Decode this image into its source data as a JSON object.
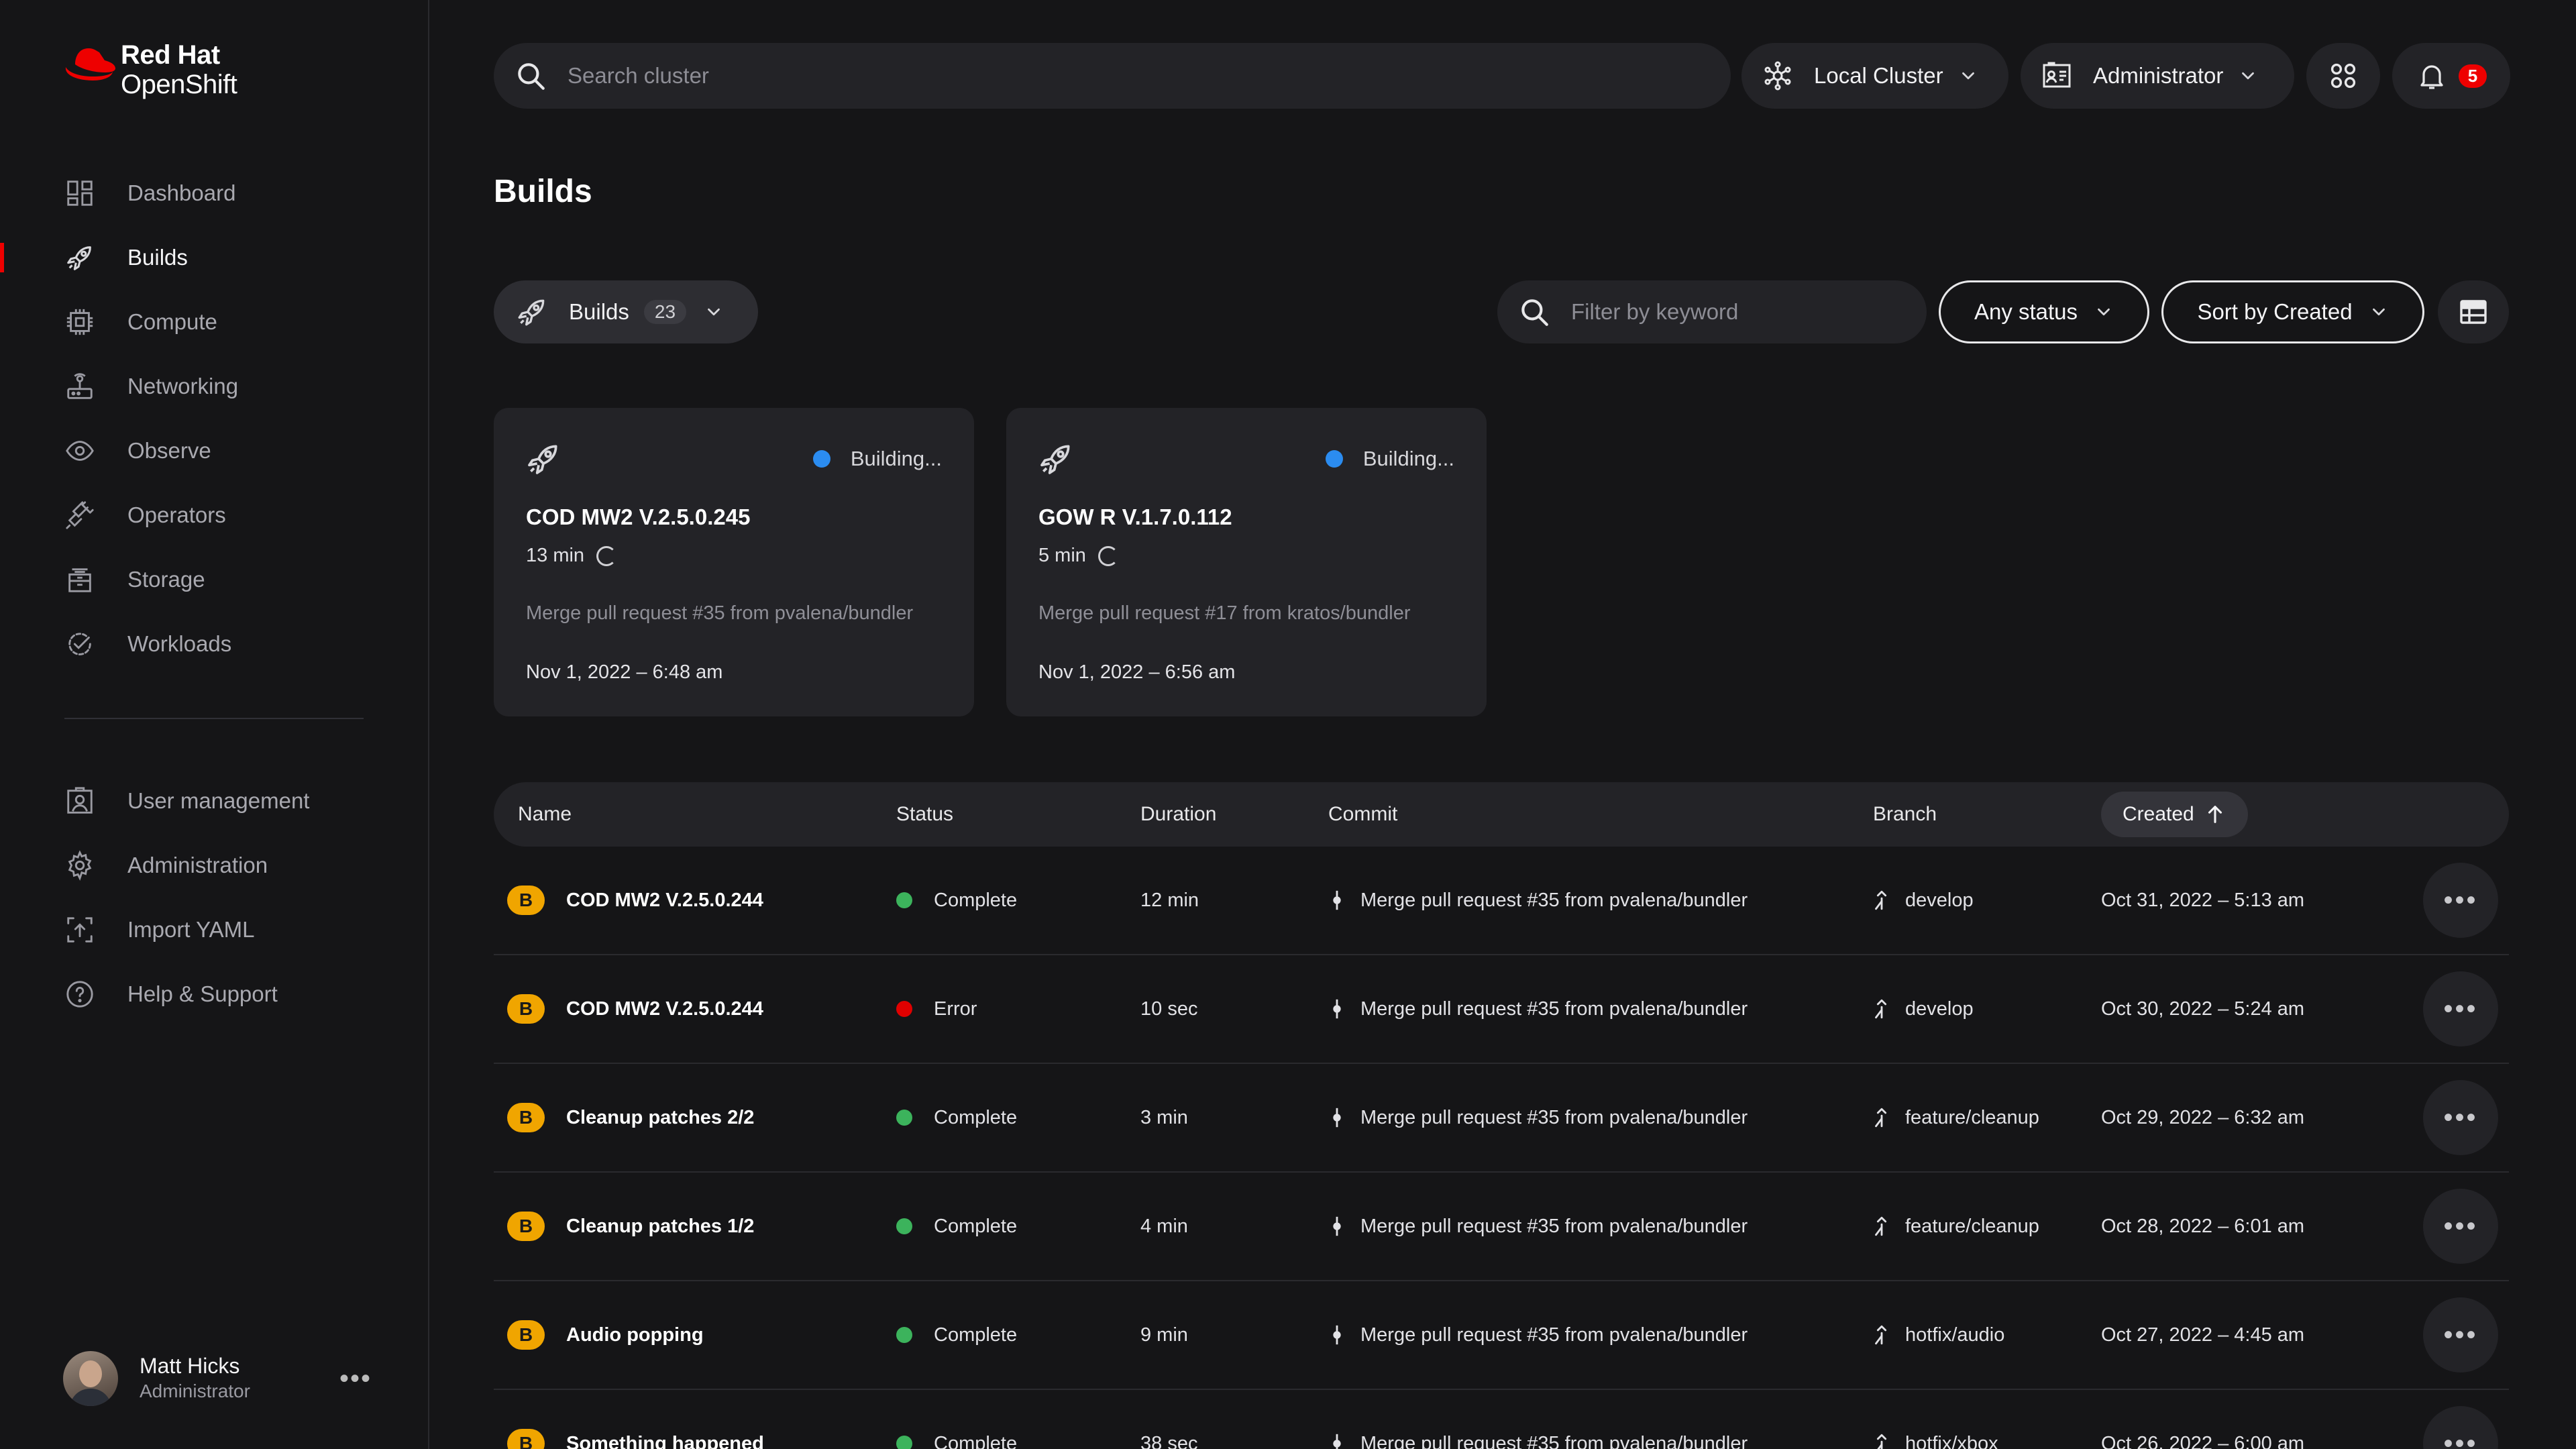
{
  "brand": {
    "line1": "Red Hat",
    "line2": "OpenShift",
    "color": "#ee0000"
  },
  "sidebar": {
    "items": [
      {
        "label": "Dashboard",
        "icon": "dashboard-icon"
      },
      {
        "label": "Builds",
        "icon": "rocket-icon",
        "active": true
      },
      {
        "label": "Compute",
        "icon": "chip-icon"
      },
      {
        "label": "Networking",
        "icon": "network-icon"
      },
      {
        "label": "Observe",
        "icon": "eye-icon"
      },
      {
        "label": "Operators",
        "icon": "plug-icon"
      },
      {
        "label": "Storage",
        "icon": "storage-icon"
      },
      {
        "label": "Workloads",
        "icon": "workloads-icon"
      }
    ],
    "secondary": [
      {
        "label": "User management",
        "icon": "user-card-icon"
      },
      {
        "label": "Administration",
        "icon": "gear-icon"
      },
      {
        "label": "Import YAML",
        "icon": "import-icon"
      },
      {
        "label": "Help & Support",
        "icon": "help-icon"
      }
    ]
  },
  "user": {
    "name": "Matt Hicks",
    "role": "Administrator"
  },
  "topbar": {
    "search_placeholder": "Search cluster",
    "cluster": "Local Cluster",
    "perspective": "Administrator",
    "notifications": "5"
  },
  "page": {
    "title": "Builds"
  },
  "filters": {
    "builds_label": "Builds",
    "builds_count": "23",
    "keyword_placeholder": "Filter by keyword",
    "status": "Any status",
    "sort": "Sort by Created"
  },
  "active_builds": [
    {
      "status": "Building...",
      "name": "COD MW2 V.2.5.0.245",
      "duration": "13 min",
      "commit": "Merge pull request #35 from pvalena/bundler",
      "date": "Nov 1, 2022 – 6:48 am"
    },
    {
      "status": "Building...",
      "name": "GOW R V.1.7.0.112",
      "duration": "5 min",
      "commit": "Merge pull request #17 from kratos/bundler",
      "date": "Nov 1, 2022 – 6:56 am"
    }
  ],
  "table": {
    "columns": [
      "Name",
      "Status",
      "Duration",
      "Commit",
      "Branch",
      "Created"
    ],
    "rows": [
      {
        "badge": "B",
        "name": "COD MW2 V.2.5.0.244",
        "status": "Complete",
        "duration": "12 min",
        "commit": "Merge pull request #35 from pvalena/bundler",
        "branch": "develop",
        "created": "Oct 31, 2022 – 5:13 am"
      },
      {
        "badge": "B",
        "name": "COD MW2 V.2.5.0.244",
        "status": "Error",
        "duration": "10 sec",
        "commit": "Merge pull request #35 from pvalena/bundler",
        "branch": "develop",
        "created": "Oct 30, 2022 – 5:24 am"
      },
      {
        "badge": "B",
        "name": "Cleanup patches 2/2",
        "status": "Complete",
        "duration": "3 min",
        "commit": "Merge pull request #35 from pvalena/bundler",
        "branch": "feature/cleanup",
        "created": "Oct 29, 2022 – 6:32 am"
      },
      {
        "badge": "B",
        "name": "Cleanup patches 1/2",
        "status": "Complete",
        "duration": "4 min",
        "commit": "Merge pull request #35 from pvalena/bundler",
        "branch": "feature/cleanup",
        "created": "Oct 28, 2022 – 6:01 am"
      },
      {
        "badge": "B",
        "name": "Audio popping",
        "status": "Complete",
        "duration": "9 min",
        "commit": "Merge pull request #35 from pvalena/bundler",
        "branch": "hotfix/audio",
        "created": "Oct 27, 2022 – 4:45 am"
      },
      {
        "badge": "B",
        "name": "Something happened",
        "status": "Complete",
        "duration": "38 sec",
        "commit": "Merge pull request #35 from pvalena/bundler",
        "branch": "hotfix/xbox",
        "created": "Oct 26, 2022 – 6:00 am"
      }
    ]
  },
  "colors": {
    "building": "#2b8cf0",
    "complete": "#3cb35c",
    "error": "#e00000",
    "badge": "#f0a500"
  }
}
